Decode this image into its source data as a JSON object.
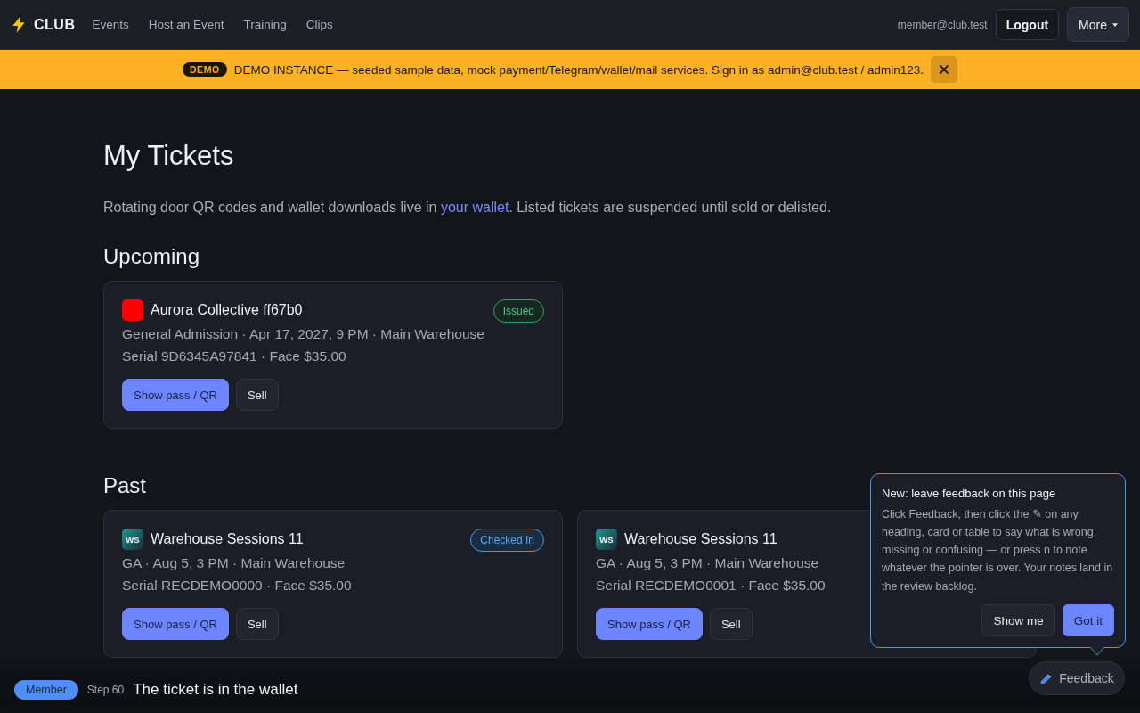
{
  "nav": {
    "brand": "CLUB",
    "links": [
      {
        "label": "Events"
      },
      {
        "label": "Host an Event"
      },
      {
        "label": "Training"
      },
      {
        "label": "Clips"
      }
    ],
    "user_email": "member@club.test",
    "logout": "Logout",
    "more": "More"
  },
  "banner": {
    "badge": "DEMO",
    "message": "DEMO INSTANCE — seeded sample data, mock payment/Telegram/wallet/mail services. Sign in as admin@club.test / admin123.",
    "dismissible": true
  },
  "page": {
    "title": "My Tickets",
    "intro": {
      "before": "Rotating door QR codes and wallet downloads live in ",
      "link": "your wallet",
      "after": ". Listed tickets are suspended until sold or delisted."
    }
  },
  "sections": [
    {
      "heading": "Upcoming",
      "tickets": [
        {
          "thumb": {
            "kind": "swatch",
            "color": "#ff0000"
          },
          "event": "Aurora Collective ff67b0",
          "status": {
            "kind": "issued",
            "label": "Issued"
          },
          "details": "General Admission · Apr 17, 2027, 9 PM · Main Warehouse",
          "serial": "Serial 9D6345A97841 · Face $35.00",
          "actions": [
            {
              "label": "Show pass / QR",
              "kind": "primary"
            },
            {
              "label": "Sell",
              "kind": "secondary"
            }
          ]
        }
      ]
    },
    {
      "heading": "Past",
      "tickets": [
        {
          "thumb": {
            "kind": "initials",
            "text": "WS"
          },
          "event": "Warehouse Sessions 11",
          "status": {
            "kind": "checked_in",
            "label": "Checked In"
          },
          "details": "GA · Aug 5, 3 PM · Main Warehouse",
          "serial": "Serial RECDEMO0000 · Face $35.00",
          "actions": [
            {
              "label": "Show pass / QR",
              "kind": "primary"
            },
            {
              "label": "Sell",
              "kind": "secondary"
            }
          ]
        },
        {
          "thumb": {
            "kind": "initials",
            "text": "WS"
          },
          "event": "Warehouse Sessions 11",
          "details": "GA · Aug 5, 3 PM · Main Warehouse",
          "serial": "Serial RECDEMO0001 · Face $35.00",
          "actions": [
            {
              "label": "Show pass / QR",
              "kind": "primary"
            },
            {
              "label": "Sell",
              "kind": "secondary"
            }
          ]
        }
      ]
    }
  ],
  "feedback_tip": {
    "title": "New: leave feedback on this page",
    "body": "Click Feedback, then click the ✎ on any heading, card or table to say what is wrong, missing or confusing — or press n to note whatever the pointer is over. Your notes land in the review backlog.",
    "buttons": [
      {
        "label": "Show me",
        "kind": "secondary"
      },
      {
        "label": "Got it",
        "kind": "primary"
      }
    ]
  },
  "feedback_button": "Feedback",
  "step_bar": {
    "role": "Member",
    "step": "Step 60",
    "caption": "The ticket is in the wallet"
  }
}
